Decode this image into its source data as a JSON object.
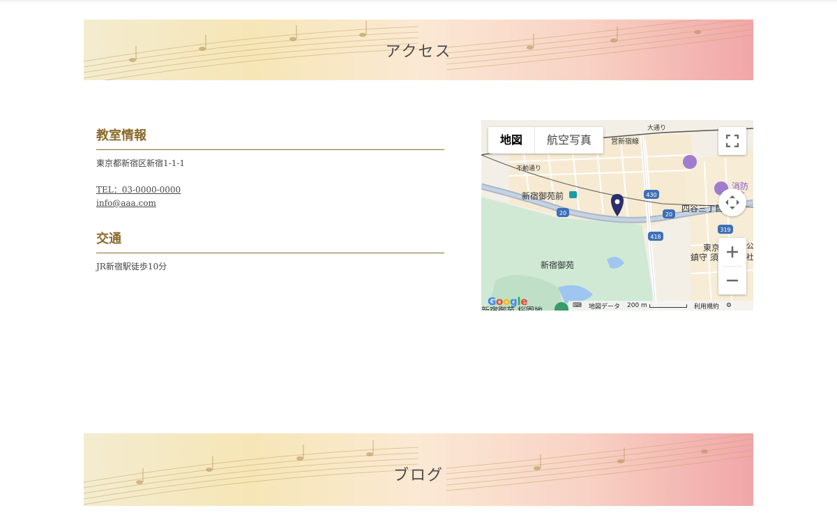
{
  "banners": {
    "access_title": "アクセス",
    "blog_title": "ブログ"
  },
  "classroom": {
    "heading": "教室情報",
    "address": "東京都新宿区新宿1-1-1",
    "tel": "TEL：03-0000-0000",
    "email": "info@aaa.com"
  },
  "transport": {
    "heading": "交通",
    "text": "JR新宿駅徒歩10分"
  },
  "map": {
    "type_map": "地図",
    "type_satellite": "航空写真",
    "labels": {
      "station": "新宿御苑前",
      "park": "新宿御苑",
      "yotsuya": "四谷三丁目",
      "tokyo_partial": "東京",
      "chinju": "鎮守 須",
      "shoubou": "消防",
      "shoubou2": "防",
      "fudou": "不動通り",
      "sen": "営新宿線",
      "odoori": "大通り",
      "bottom_left": "新宿御苑 桜園地",
      "ko": "公",
      "sha": "社"
    },
    "route_numbers": [
      "20",
      "20",
      "430",
      "418",
      "319"
    ],
    "attribution": {
      "logo": "Google",
      "map_data": "地図データ",
      "scale": "200 m",
      "terms": "利用規約"
    }
  }
}
